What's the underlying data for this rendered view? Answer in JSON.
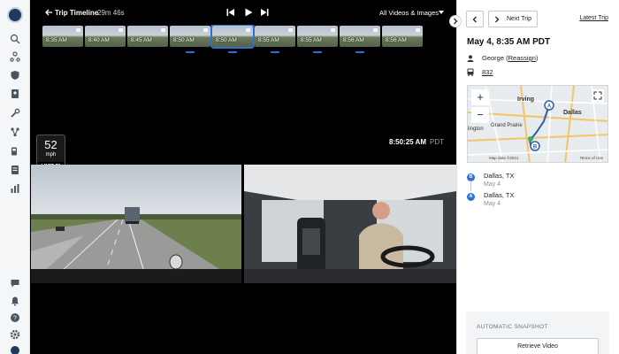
{
  "header": {
    "title": "Trip Timeline",
    "duration": "29m 46s",
    "filter_label": "All Videos & Images"
  },
  "timeline": {
    "thumbnails": [
      "8:35 AM",
      "8:40 AM",
      "8:45 AM",
      "8:50 AM",
      "8:50 AM",
      "8:55 AM",
      "8:55 AM",
      "8:56 AM",
      "8:56 AM"
    ],
    "selected_index": 4
  },
  "overlay": {
    "speed_value": "52",
    "speed_unit": "mph",
    "speed_limit": "LIMIT 70",
    "timestamp": "8:50:25 AM",
    "timezone": "PDT"
  },
  "panel": {
    "next_trip_label": "Next Trip",
    "latest_trip_label": "Latest Trip",
    "title": "May 4, 8:35 AM PDT",
    "driver_name": "George",
    "reassign_label": "Reassign",
    "vehicle_id": "832",
    "map": {
      "labels": {
        "irving": "Irving",
        "dallas": "Dallas",
        "arlington": "lington",
        "grand_prairie": "Grand Prairie"
      },
      "copyright": "Map data ©2021",
      "terms": "Terms of Use",
      "zoom_in": "+",
      "zoom_out": "−"
    },
    "stops": [
      {
        "marker": "B",
        "city": "Dallas, TX",
        "date": "May 4"
      },
      {
        "marker": "A",
        "city": "Dallas, TX",
        "date": "May 4"
      }
    ],
    "snapshot": {
      "title": "AUTOMATIC SNAPSHOT",
      "button_label": "Retrieve Video"
    }
  },
  "colors": {
    "accent": "#2f6fd6",
    "nav_bg": "#f5f6f8",
    "video_bg": "#000000"
  }
}
